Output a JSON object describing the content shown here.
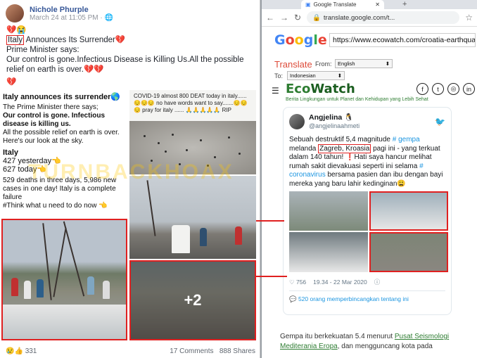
{
  "facebook": {
    "author": "Nichole Phurple",
    "timestamp": "March 24 at 11:05 PM · 🌐",
    "emoji_line1": "💔😭",
    "headline_word": "Italy",
    "headline_rest": "Announces Its Surrender💔",
    "line2": "Prime Minister says:",
    "line3": "Our control is gone.Infectious Disease is Killing Us.All the possible relief on earth is over.💔💔",
    "emoji_line4": "💔",
    "reactions_count": "331",
    "comments": "17 Comments",
    "shares": "888 Shares",
    "more_photos": "+2"
  },
  "image_caption": {
    "title": "Italy announces its surrender🌎",
    "l1": "The Prime Minister there says;",
    "l2": "Our control is gone. Infectious disease is killing us.",
    "l3": "All the possible relief on earth is over. Here's our look at the sky.",
    "italy": "Italy",
    "stat1": "427 yesterday👈",
    "stat2": "627 today👈",
    "deaths": "529 deaths in three days, 5,986 new cases in one day! Italy is a complete failure",
    "think": "#Think what u need to do now 👈"
  },
  "image_tweet_text": "COVID-19 almost 800 DEAT today in italy...... 😔😔😔 no have words want to say.......😔😔😔 pray for italy ...... 🙏🙏🙏🙏🙏 RIP",
  "watermark": "TURNBACKHOAX",
  "browser": {
    "tab_title": "Google Translate",
    "url": "translate.google.com/t...",
    "google_url": "https://www.ecowatch.com/croatia-earthquake-c...",
    "translate_label": "Translate",
    "from_label": "From:",
    "from_lang": "English",
    "to_label": "To:",
    "to_lang": "Indonesian"
  },
  "ecowatch": {
    "logo_a": "Eco",
    "logo_b": "Watch",
    "tagline": "Berita Lingkungan untuk Planet dan Kehidupan yang Lebih Sehat"
  },
  "tweet": {
    "name": "Angjelina 🐧",
    "handle": "@angjelinaahmeti",
    "text_a": "Sebuah destruktif 5,4 magnitude",
    "tag1": "# gempa",
    "text_b": "melanda",
    "place": "Zagreb, Kroasia",
    "text_c": "pagi ini - yang terkuat dalam 140 tahun! ❗Hati saya hancur melihat rumah sakit dievakuasi seperti ini selama",
    "tag2": "# coronavirus",
    "text_d": "bersama pasien dan ibu dengan bayi mereka yang baru lahir kedinginan😩",
    "likes": "♡ 756",
    "time": "19.34 - 22 Mar 2020",
    "talk": "520 orang memperbincangkan tentang ini"
  },
  "article": {
    "text_a": "Gempa itu berkekuatan 5.4 menurut",
    "link": "Pusat Seismologi Mediterania Eropa",
    "text_b": ", dan mengguncang kota pada"
  }
}
